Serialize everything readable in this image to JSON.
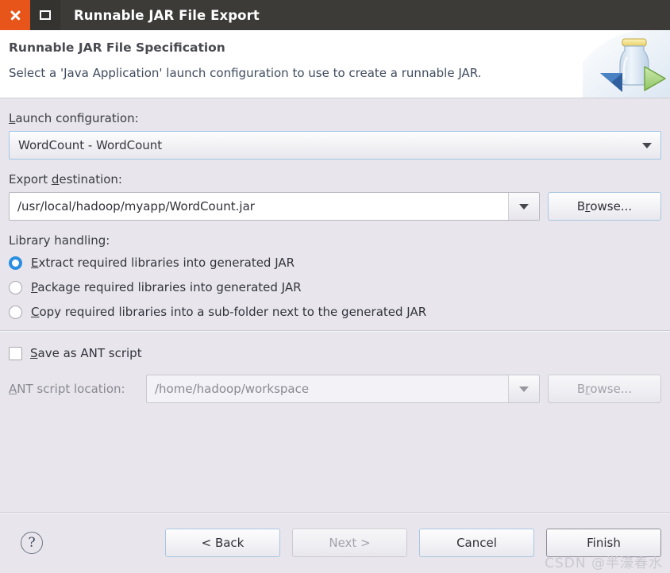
{
  "window": {
    "title": "Runnable JAR File Export",
    "close_icon": "close-icon",
    "maximize_icon": "maximize-icon"
  },
  "header": {
    "title": "Runnable JAR File Specification",
    "description": "Select a 'Java Application' launch configuration to use to create a runnable JAR.",
    "icon": "jar-export-icon"
  },
  "launch_configuration": {
    "label_pre": "L",
    "label_post": "aunch configuration:",
    "value": "WordCount - WordCount",
    "dropdown_icon": "chevron-down-icon"
  },
  "export_destination": {
    "label_pre": "Export ",
    "label_mn": "d",
    "label_post": "estination:",
    "value": "/usr/local/hadoop/myapp/WordCount.jar",
    "dropdown_icon": "chevron-down-icon",
    "browse_pre": "B",
    "browse_mn": "r",
    "browse_post": "owse..."
  },
  "library_handling": {
    "label": "Library handling:",
    "options": [
      {
        "mn": "E",
        "rest": "xtract required libraries into generated JAR",
        "selected": true
      },
      {
        "mn": "P",
        "rest": "ackage required libraries into generated JAR",
        "selected": false
      },
      {
        "mn": "C",
        "rest": "opy required libraries into a sub-folder next to the generated JAR",
        "selected": false
      }
    ]
  },
  "ant": {
    "checkbox_mn": "S",
    "checkbox_rest": "ave as ANT script",
    "checked": false,
    "location_mn": "A",
    "location_rest": "NT script location:",
    "location_value": "/home/hadoop/workspace",
    "dropdown_icon": "chevron-down-icon",
    "browse_pre": "B",
    "browse_mn": "r",
    "browse_post": "owse...",
    "disabled": true
  },
  "footer": {
    "help_icon": "help-question-icon",
    "back_label": "< Back",
    "next_label": "Next >",
    "next_disabled": true,
    "cancel_label": "Cancel",
    "finish_label": "Finish",
    "finish_default": true
  },
  "watermark": {
    "text": "CSDN @半濠春水"
  },
  "colors": {
    "titlebar_bg": "#3c3b37",
    "close_button": "#e8551b",
    "body_bg": "#e8e6ec",
    "header_bg": "#ffffff",
    "radio_accent": "#2a8fe0",
    "focus_border": "#9fc5e8"
  }
}
